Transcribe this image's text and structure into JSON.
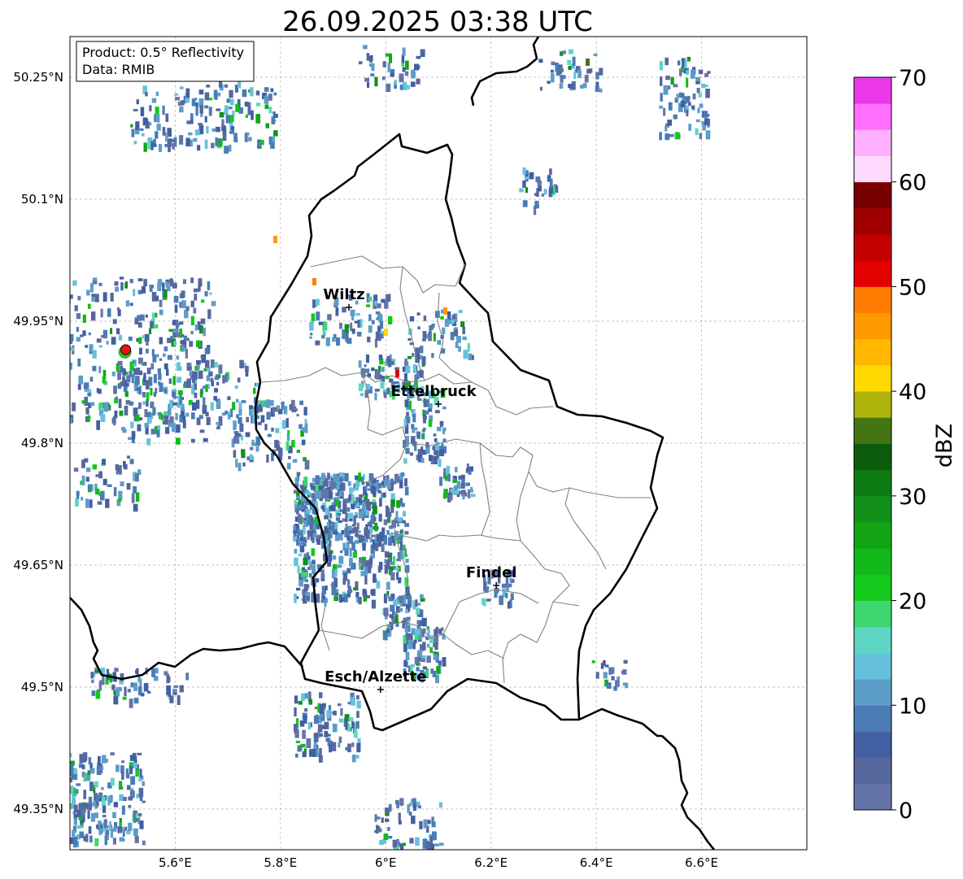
{
  "title": "26.09.2025 03:38 UTC",
  "info_box": {
    "product": "Product: 0.5° Reflectivity",
    "data": "Data: RMIB"
  },
  "map": {
    "lon_range": [
      5.4,
      6.8
    ],
    "lat_range": [
      49.3,
      50.3
    ],
    "lon_ticks": [
      {
        "value": 5.6,
        "label": "5.6°E"
      },
      {
        "value": 5.8,
        "label": "5.8°E"
      },
      {
        "value": 6.0,
        "label": "6°E"
      },
      {
        "value": 6.2,
        "label": "6.2°E"
      },
      {
        "value": 6.4,
        "label": "6.4°E"
      },
      {
        "value": 6.6,
        "label": "6.6°E"
      }
    ],
    "lat_ticks": [
      {
        "value": 49.35,
        "label": "49.35°N"
      },
      {
        "value": 49.5,
        "label": "49.5°N"
      },
      {
        "value": 49.65,
        "label": "49.65°N"
      },
      {
        "value": 49.8,
        "label": "49.8°N"
      },
      {
        "value": 49.95,
        "label": "49.95°N"
      },
      {
        "value": 50.1,
        "label": "50.1°N"
      },
      {
        "value": 50.25,
        "label": "50.25°N"
      }
    ],
    "gridlines": true,
    "cities": [
      {
        "name": "Wiltz",
        "lon": 5.93,
        "lat": 49.967
      },
      {
        "name": "Ettelbruck",
        "lon": 6.1,
        "lat": 49.848
      },
      {
        "name": "Findel",
        "lon": 6.21,
        "lat": 49.625
      },
      {
        "name": "Esch/Alzette",
        "lon": 5.99,
        "lat": 49.497
      }
    ],
    "radar_site": {
      "lon": 5.506,
      "lat": 49.915,
      "color": "#ee1111",
      "ring_color": "#22aa22"
    },
    "border_color": "#000000",
    "canton_color": "#808080"
  },
  "colorbar": {
    "label": "dBZ",
    "min": 0,
    "max": 70,
    "tick_values": [
      0,
      10,
      20,
      30,
      40,
      50,
      60,
      70
    ],
    "colors": [
      "#6574a8",
      "#56679e",
      "#435fa3",
      "#4b7cb4",
      "#5c9dc8",
      "#66c1dc",
      "#5fd6c3",
      "#3ed66e",
      "#12c91c",
      "#12b918",
      "#13a514",
      "#11901a",
      "#0f7b15",
      "#0b5d0b",
      "#457513",
      "#adb30b",
      "#ffd800",
      "#ffb700",
      "#ff9900",
      "#ff7d00",
      "#e40000",
      "#c40000",
      "#a00000",
      "#780000",
      "#ffdaff",
      "#ffb0ff",
      "#ff6eff",
      "#ea38ea"
    ]
  }
}
